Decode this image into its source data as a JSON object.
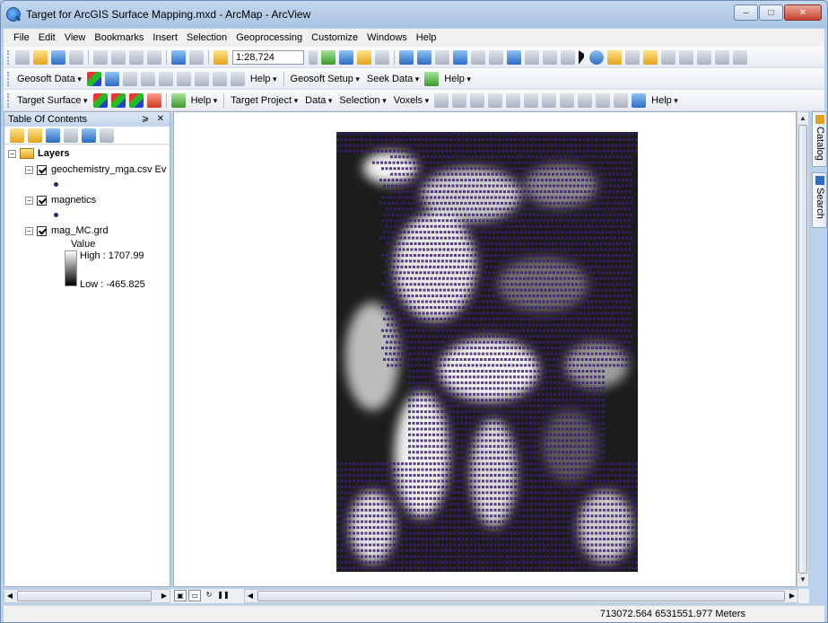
{
  "window": {
    "title": "Target for ArcGIS Surface Mapping.mxd - ArcMap - ArcView",
    "buttons": {
      "minimize": "–",
      "maximize": "□",
      "close": "✕"
    }
  },
  "menubar": [
    "File",
    "Edit",
    "View",
    "Bookmarks",
    "Insert",
    "Selection",
    "Geoprocessing",
    "Customize",
    "Windows",
    "Help"
  ],
  "toolbar1": {
    "scale": "1:28,724"
  },
  "toolbar2": {
    "geosoft_data": "Geosoft Data",
    "help1": "Help",
    "geosoft_setup": "Geosoft Setup",
    "seek_data": "Seek Data",
    "help2": "Help"
  },
  "toolbar3": {
    "target_surface": "Target Surface",
    "help1": "Help",
    "target_project": "Target Project",
    "data": "Data",
    "selection": "Selection",
    "voxels": "Voxels",
    "help2": "Help"
  },
  "toc": {
    "title": "Table Of Contents",
    "pin": "⩾",
    "close": "✕",
    "root": "Layers",
    "layers": [
      {
        "name": "geochemistry_mga.csv Ev"
      },
      {
        "name": "magnetics"
      },
      {
        "name": "mag_MC.grd",
        "legend_title": "Value",
        "high": "High : 1707.99",
        "low": "Low : -465.825"
      }
    ]
  },
  "sidetabs": {
    "catalog": "Catalog",
    "search": "Search"
  },
  "status": {
    "coordinates": "713072.564  6531551.977 Meters"
  },
  "colors": {
    "point_color": "#3b1f6e",
    "titlebar": "#a9c4e3",
    "panel_header": "#c3d4ea"
  }
}
